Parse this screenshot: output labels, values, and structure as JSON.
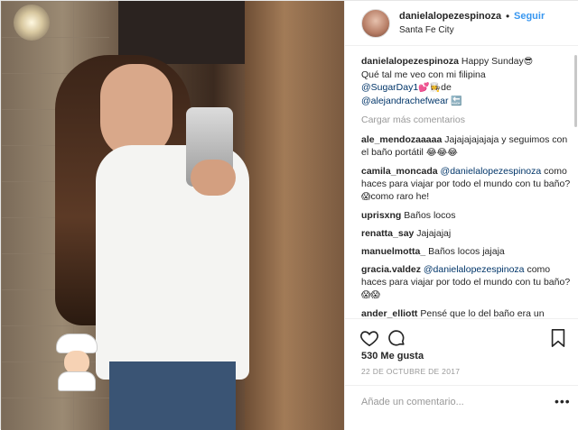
{
  "header": {
    "username": "danielalopezespinoza",
    "dot": "•",
    "follow_label": "Seguir",
    "location": "Santa Fe City"
  },
  "caption": {
    "username": "danielalopezespinoza",
    "text1": " Happy Sunday",
    "emoji1": "😎",
    "text2": "Qué tal me veo con mi filipina ",
    "mention1": "@SugarDay1",
    "emoji2": "💕👩‍🍳",
    "text3": "de",
    "mention2": "@alejandrachefwear",
    "emoji3": "🔙"
  },
  "load_more_label": "Cargar más comentarios",
  "comments": [
    {
      "user": "ale_mendozaaaaa",
      "mention": "",
      "text": " Jajajajajajaja y seguimos con el baño portátil",
      "emoji": "😂😂😂"
    },
    {
      "user": "camila_moncada",
      "mention": " @danielalopezespinoza",
      "text": " como haces para viajar por todo el mundo con tu baño?",
      "emoji": "😱",
      "text_after": "como raro he!"
    },
    {
      "user": "uprisxng",
      "mention": "",
      "text": " Baños locos",
      "emoji": ""
    },
    {
      "user": "renatta_say",
      "mention": "",
      "text": " Jajajajaj",
      "emoji": ""
    },
    {
      "user": "manuelmotta_",
      "mention": "",
      "text": " Baños locos jajaja",
      "emoji": ""
    },
    {
      "user": "gracia.valdez",
      "mention": " @danielalopezespinoza",
      "text": " como haces para viajar por todo el mundo con tu baño?",
      "emoji": "😱😱"
    },
    {
      "user": "ander_elliott",
      "mention": "",
      "text": " Pensé que lo del baño era un montaje pero si existe!!! Jajaja",
      "emoji": ""
    }
  ],
  "likes": "530 Me gusta",
  "date": "22 DE OCTUBRE DE 2017",
  "add_comment": {
    "placeholder": "Añade un comentario..."
  },
  "options_label": "•••",
  "icons": {
    "like": "heart-icon",
    "comment": "comment-bubble-icon",
    "save": "bookmark-icon",
    "options": "more-options-icon"
  },
  "colors": {
    "link": "#3897f0",
    "mention": "#003569",
    "muted": "#999999",
    "text": "#262626"
  }
}
